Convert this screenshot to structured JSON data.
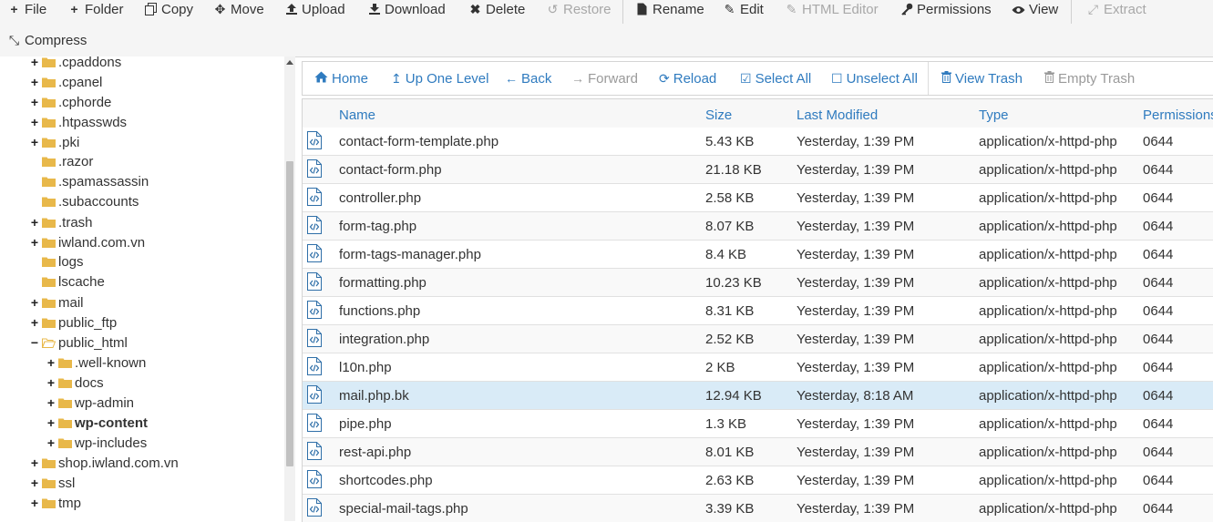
{
  "toolbar": {
    "file": "File",
    "folder": "Folder",
    "copy": "Copy",
    "move": "Move",
    "upload": "Upload",
    "download": "Download",
    "delete": "Delete",
    "restore": "Restore",
    "rename": "Rename",
    "edit": "Edit",
    "html_editor": "HTML Editor",
    "permissions": "Permissions",
    "view": "View",
    "extract": "Extract",
    "compress": "Compress"
  },
  "tree": {
    "items": [
      {
        "label": ".cpaddons",
        "toggle": "+"
      },
      {
        "label": ".cpanel",
        "toggle": "+"
      },
      {
        "label": ".cphorde",
        "toggle": "+"
      },
      {
        "label": ".htpasswds",
        "toggle": "+"
      },
      {
        "label": ".pki",
        "toggle": "+"
      },
      {
        "label": ".razor",
        "toggle": ""
      },
      {
        "label": ".spamassassin",
        "toggle": ""
      },
      {
        "label": ".subaccounts",
        "toggle": ""
      },
      {
        "label": ".trash",
        "toggle": "+"
      },
      {
        "label": "iwland.com.vn",
        "toggle": "+"
      },
      {
        "label": "logs",
        "toggle": ""
      },
      {
        "label": "lscache",
        "toggle": ""
      },
      {
        "label": "mail",
        "toggle": "+"
      },
      {
        "label": "public_ftp",
        "toggle": "+"
      },
      {
        "label": "public_html",
        "toggle": "−"
      },
      {
        "label": ".well-known",
        "toggle": "+"
      },
      {
        "label": "docs",
        "toggle": "+"
      },
      {
        "label": "wp-admin",
        "toggle": "+"
      },
      {
        "label": "wp-content",
        "toggle": "+"
      },
      {
        "label": "wp-includes",
        "toggle": "+"
      },
      {
        "label": "shop.iwland.com.vn",
        "toggle": "+"
      },
      {
        "label": "ssl",
        "toggle": "+"
      },
      {
        "label": "tmp",
        "toggle": "+"
      }
    ]
  },
  "nav": {
    "home": "Home",
    "up_one_level": "Up One Level",
    "back": "Back",
    "forward": "Forward",
    "reload": "Reload",
    "select_all": "Select All",
    "unselect_all": "Unselect All",
    "view_trash": "View Trash",
    "empty_trash": "Empty Trash"
  },
  "table": {
    "columns": [
      "Name",
      "Size",
      "Last Modified",
      "Type",
      "Permissions"
    ],
    "rows": [
      {
        "name": "contact-form-template.php",
        "size": "5.43 KB",
        "modified": "Yesterday, 1:39 PM",
        "type": "application/x-httpd-php",
        "perm": "0644"
      },
      {
        "name": "contact-form.php",
        "size": "21.18 KB",
        "modified": "Yesterday, 1:39 PM",
        "type": "application/x-httpd-php",
        "perm": "0644"
      },
      {
        "name": "controller.php",
        "size": "2.58 KB",
        "modified": "Yesterday, 1:39 PM",
        "type": "application/x-httpd-php",
        "perm": "0644"
      },
      {
        "name": "form-tag.php",
        "size": "8.07 KB",
        "modified": "Yesterday, 1:39 PM",
        "type": "application/x-httpd-php",
        "perm": "0644"
      },
      {
        "name": "form-tags-manager.php",
        "size": "8.4 KB",
        "modified": "Yesterday, 1:39 PM",
        "type": "application/x-httpd-php",
        "perm": "0644"
      },
      {
        "name": "formatting.php",
        "size": "10.23 KB",
        "modified": "Yesterday, 1:39 PM",
        "type": "application/x-httpd-php",
        "perm": "0644"
      },
      {
        "name": "functions.php",
        "size": "8.31 KB",
        "modified": "Yesterday, 1:39 PM",
        "type": "application/x-httpd-php",
        "perm": "0644"
      },
      {
        "name": "integration.php",
        "size": "2.52 KB",
        "modified": "Yesterday, 1:39 PM",
        "type": "application/x-httpd-php",
        "perm": "0644"
      },
      {
        "name": "l10n.php",
        "size": "2 KB",
        "modified": "Yesterday, 1:39 PM",
        "type": "application/x-httpd-php",
        "perm": "0644"
      },
      {
        "name": "mail.php.bk",
        "size": "12.94 KB",
        "modified": "Yesterday, 8:18 AM",
        "type": "application/x-httpd-php",
        "perm": "0644",
        "selected": true
      },
      {
        "name": "pipe.php",
        "size": "1.3 KB",
        "modified": "Yesterday, 1:39 PM",
        "type": "application/x-httpd-php",
        "perm": "0644"
      },
      {
        "name": "rest-api.php",
        "size": "8.01 KB",
        "modified": "Yesterday, 1:39 PM",
        "type": "application/x-httpd-php",
        "perm": "0644"
      },
      {
        "name": "shortcodes.php",
        "size": "2.63 KB",
        "modified": "Yesterday, 1:39 PM",
        "type": "application/x-httpd-php",
        "perm": "0644"
      },
      {
        "name": "special-mail-tags.php",
        "size": "3.39 KB",
        "modified": "Yesterday, 1:39 PM",
        "type": "application/x-httpd-php",
        "perm": "0644"
      }
    ]
  },
  "colors": {
    "link": "#2f7bbf",
    "folder": "#e8b84a",
    "selected_row": "#d9ebf7",
    "disabled": "#a8a8a8"
  },
  "icons": {
    "file_row": "php-file-icon",
    "tree": "folder-icon"
  }
}
